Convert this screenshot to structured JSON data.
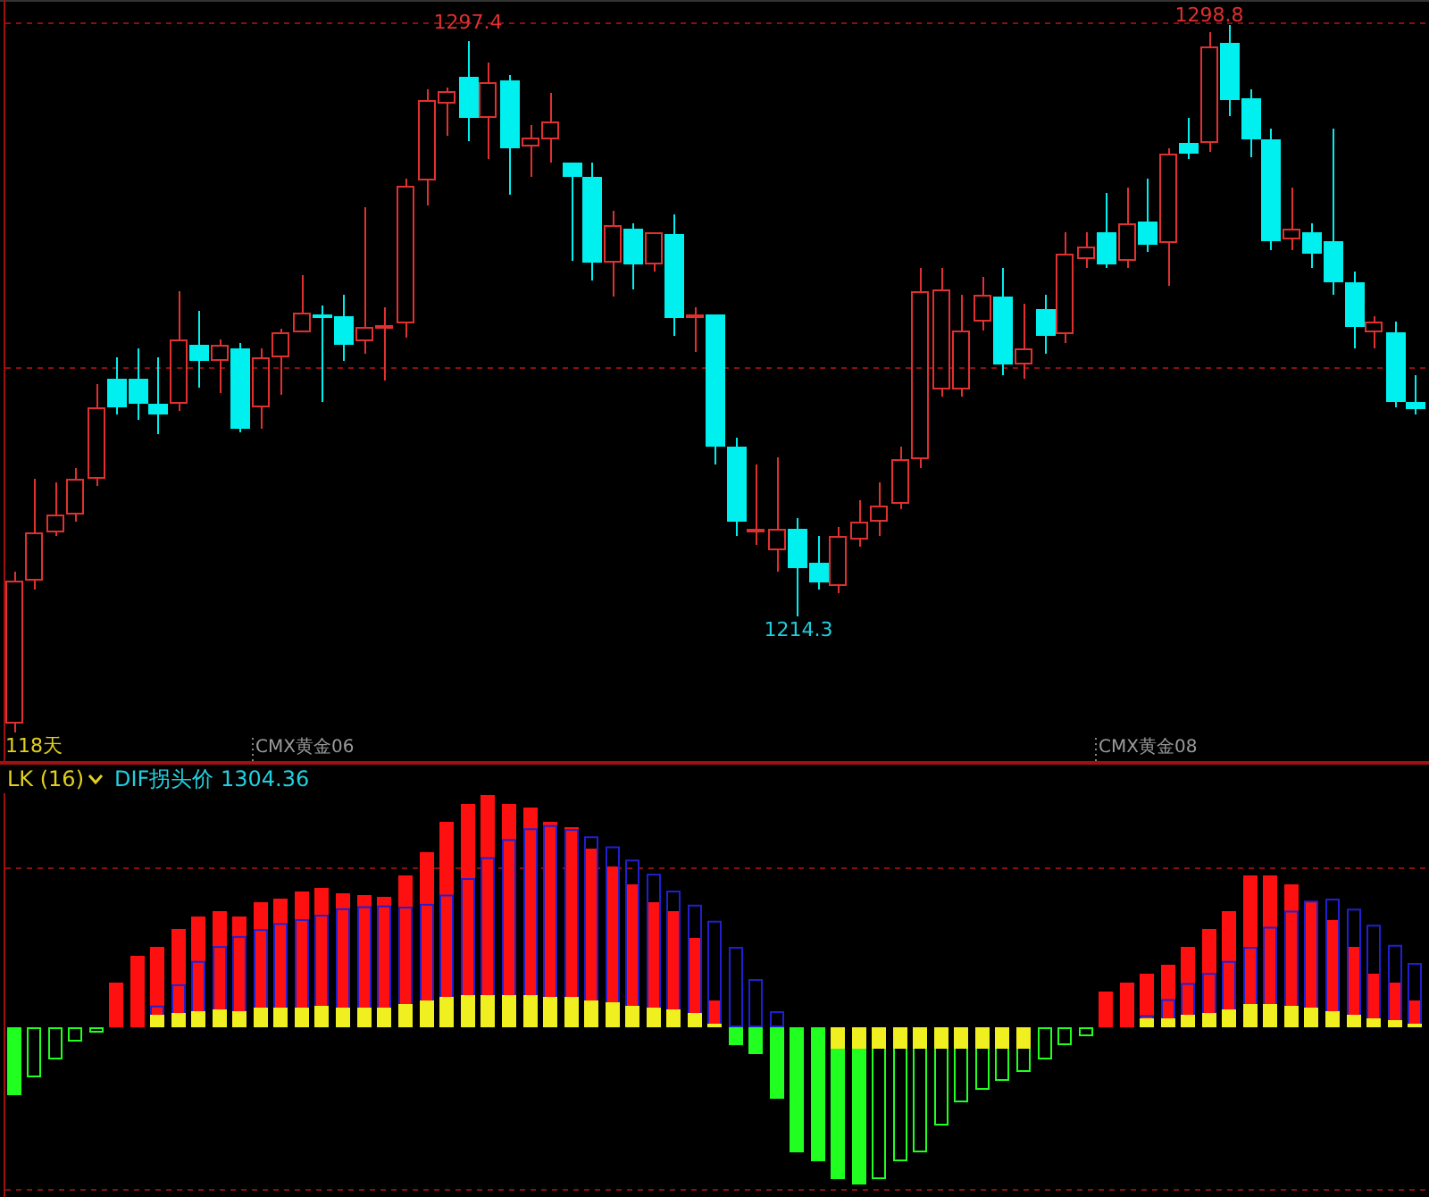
{
  "price_chart": {
    "extreme_labels": [
      {
        "text": "1297.4",
        "kind": "high"
      },
      {
        "text": "1298.8",
        "kind": "high"
      },
      {
        "text": "1214.3",
        "kind": "low"
      }
    ],
    "bar_count": "118天",
    "contract_labels": [
      "CMX黄金06",
      "CMX黄金08"
    ]
  },
  "indicator": {
    "name": "LK (16)",
    "value_label": "DIF拐头价 1304.36"
  }
}
